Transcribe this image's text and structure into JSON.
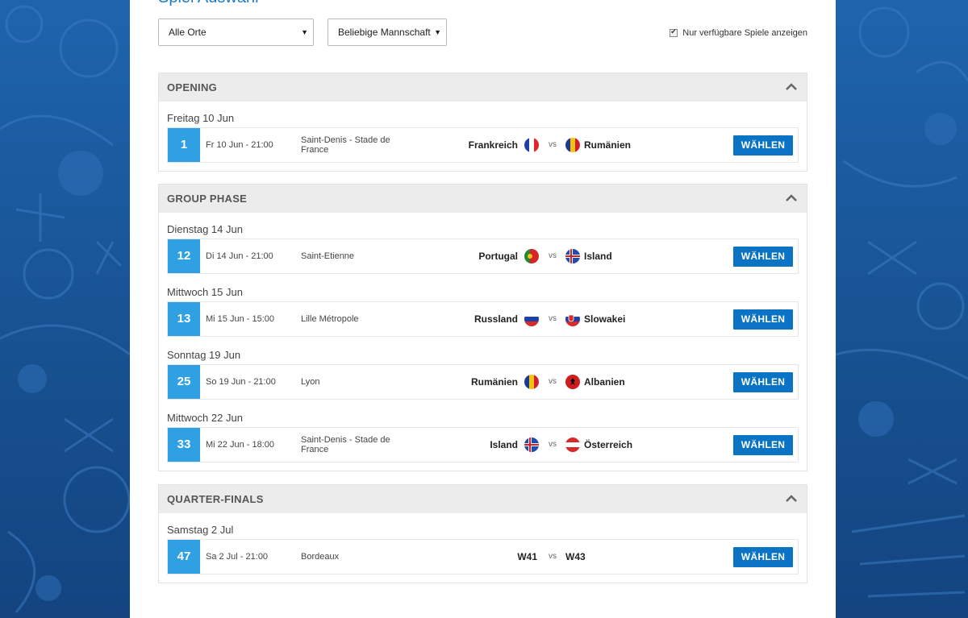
{
  "page": {
    "title": "Spiel Auswahl"
  },
  "filters": {
    "location": "Alle Orte",
    "team": "Beliebige Mannschaft",
    "only_available_label": "Nur verfügbare Spiele anzeigen"
  },
  "sections": [
    {
      "title": "OPENING",
      "days": [
        {
          "label": "Freitag 10 Jun",
          "matches": [
            {
              "number": "1",
              "date": "Fr 10 Jun - 21:00",
              "venue": "Saint-Denis - Stade de France",
              "home": "Frankreich",
              "home_flag": "france-flag-icon",
              "vs": "vs",
              "away": "Rumänien",
              "away_flag": "romania-flag-icon",
              "button": "WÄHLEN"
            }
          ]
        }
      ]
    },
    {
      "title": "GROUP PHASE",
      "days": [
        {
          "label": "Dienstag 14 Jun",
          "matches": [
            {
              "number": "12",
              "date": "Di 14 Jun - 21:00",
              "venue": "Saint-Etienne",
              "home": "Portugal",
              "home_flag": "portugal-flag-icon",
              "vs": "vs",
              "away": "Island",
              "away_flag": "iceland-flag-icon",
              "button": "WÄHLEN"
            }
          ]
        },
        {
          "label": "Mittwoch 15 Jun",
          "matches": [
            {
              "number": "13",
              "date": "Mi 15 Jun - 15:00",
              "venue": "Lille Métropole",
              "home": "Russland",
              "home_flag": "russia-flag-icon",
              "vs": "vs",
              "away": "Slowakei",
              "away_flag": "slovakia-flag-icon",
              "button": "WÄHLEN"
            }
          ]
        },
        {
          "label": "Sonntag 19 Jun",
          "matches": [
            {
              "number": "25",
              "date": "So 19 Jun - 21:00",
              "venue": "Lyon",
              "home": "Rumänien",
              "home_flag": "romania-flag-icon",
              "vs": "vs",
              "away": "Albanien",
              "away_flag": "albania-flag-icon",
              "button": "WÄHLEN"
            }
          ]
        },
        {
          "label": "Mittwoch 22 Jun",
          "matches": [
            {
              "number": "33",
              "date": "Mi 22 Jun - 18:00",
              "venue": "Saint-Denis - Stade de France",
              "home": "Island",
              "home_flag": "iceland-flag-icon",
              "vs": "vs",
              "away": "Österreich",
              "away_flag": "austria-flag-icon",
              "button": "WÄHLEN"
            }
          ]
        }
      ]
    },
    {
      "title": "QUARTER-FINALS",
      "days": [
        {
          "label": "Samstag 2 Jul",
          "matches": [
            {
              "number": "47",
              "date": "Sa 2 Jul - 21:00",
              "venue": "Bordeaux",
              "home": "W41",
              "vs": "vs",
              "away": "W43",
              "button": "WÄHLEN"
            }
          ]
        }
      ]
    }
  ],
  "colors": {
    "accent": "#0a73c4",
    "match_number": "#2fa1e3",
    "header_bg": "#ececec",
    "background": "#1d5aa0"
  }
}
